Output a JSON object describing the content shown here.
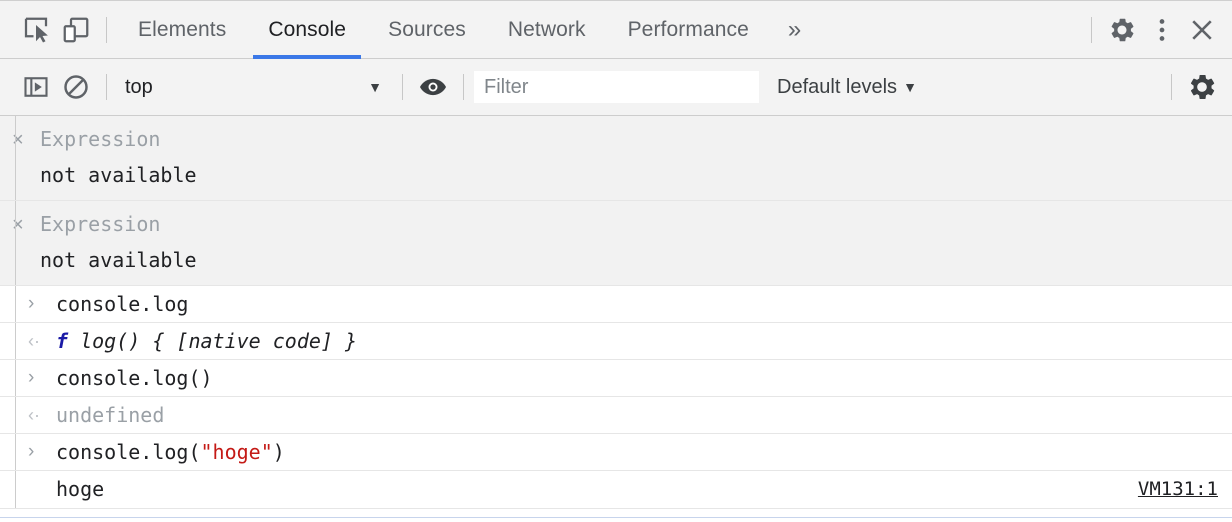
{
  "tabbar": {
    "inspect_icon": "inspect-element-icon",
    "device_icon": "device-toolbar-icon",
    "tabs": [
      {
        "label": "Elements",
        "active": false
      },
      {
        "label": "Console",
        "active": true
      },
      {
        "label": "Sources",
        "active": false
      },
      {
        "label": "Network",
        "active": false
      },
      {
        "label": "Performance",
        "active": false
      }
    ],
    "more_label": "»",
    "settings_icon": "gear-icon",
    "menu_icon": "kebab-menu-icon",
    "close_icon": "close-icon",
    "active_underline_color": "#3b78e7"
  },
  "filterbar": {
    "sidebar_toggle_icon": "console-sidebar-toggle-icon",
    "clear_icon": "clear-console-icon",
    "context": "top",
    "context_caret": "▼",
    "eye_icon": "live-expression-eye-icon",
    "filter_placeholder": "Filter",
    "filter_value": "",
    "levels_label": "Default levels",
    "levels_caret": "▼",
    "settings_icon": "console-settings-gear-icon"
  },
  "console": {
    "live_expressions": [
      {
        "close_glyph": "×",
        "title": "Expression",
        "body": "not available"
      },
      {
        "close_glyph": "×",
        "title": "Expression",
        "body": "not available"
      }
    ],
    "entries": [
      {
        "type": "input",
        "prompt": "›",
        "code": "console.log"
      },
      {
        "type": "result",
        "prompt": "‹·",
        "fn_keyword": "f",
        "fn_body": " log() { [native code] }"
      },
      {
        "type": "input",
        "prompt": "›",
        "code": "console.log()"
      },
      {
        "type": "result_undefined",
        "prompt": "‹·",
        "value": "undefined"
      },
      {
        "type": "input_string",
        "prompt": "›",
        "code_prefix": "console.log(",
        "code_string": "\"hoge\"",
        "code_suffix": ")"
      },
      {
        "type": "log",
        "text": "hoge",
        "source": "VM131:1"
      }
    ]
  },
  "colors": {
    "accent": "#3b78e7",
    "string_literal": "#c41a16",
    "function_keyword": "#1a1aa6",
    "muted": "#9aa0a6",
    "toolbar_bg": "#f3f3f3",
    "expression_bg": "#f2f2f2"
  }
}
